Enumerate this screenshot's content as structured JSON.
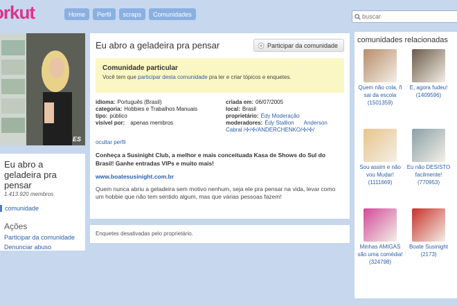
{
  "header": {
    "logo": "orkut",
    "nav": [
      "Home",
      "Perfil",
      "scraps",
      "Comunidades"
    ],
    "search_placeholder": "buscar"
  },
  "left": {
    "community_title": "Eu abro a geladeira pra pensar",
    "members": "1.413.920 membros",
    "comunidade_link": "comunidade",
    "acoes_heading": "Ações",
    "acoes": [
      "Participar da comunidade",
      "Denunciar abuso"
    ],
    "photo_watermark": "ES"
  },
  "main": {
    "title": "Eu abro a geladeira pra pensar",
    "join_button": "Participar da comunidade",
    "private_title": "Comunidade particular",
    "private_text_before": "Você tem que ",
    "private_text_link": "participar desta comunidade",
    "private_text_after": " pra ler e criar tópicos e enquetes.",
    "info": {
      "idioma_k": "idioma:",
      "idioma_v": "Português (Brasil)",
      "categoria_k": "categoria:",
      "categoria_v": "Hobbies e Trabalhos Manuais",
      "tipo_k": "tipo:",
      "tipo_v": "público",
      "visivel_k": "visível por:",
      "visivel_v": "apenas membros",
      "criada_k": "criada em:",
      "criada_v": "06/07/2005",
      "local_k": "local:",
      "local_v": "Brasil",
      "proprietario_k": "proprietário:",
      "proprietario_v": "Édy Moderação",
      "moderadores_k": "moderadores:",
      "moderadores_v1": "Édy Stallion",
      "moderadores_v2": "Anderson",
      "moderadores_v3": "Cabral /✣/✣/ANDERCHENKO/✣/✣/"
    },
    "ocultar": "ocultar perfil",
    "desc_bold": "Conheça a Susinight Club, a melhor e mais conceituada Kasa de Shows do Sul do Brasil! Ganhe entradas VIPs e muito mais!",
    "site": "www.boatesusinight.com.br",
    "desc": "Quem nunca abriu a geladeira sem motivo nenhum, seja ele pra pensar na vida, levar como um hobbie que não tem sentido algum, mas que várias pessoas fazem!",
    "enquetes": "Enquetes desativadas pelo proprietário."
  },
  "right": {
    "heading": "comunidades relacionadas",
    "items": [
      {
        "name": "Quem não cola, ñ sai da escola (1501359)",
        "color": "#b88c6a"
      },
      {
        "name": "E, agora fudeu! (1409596)",
        "color": "#6b5a48"
      },
      {
        "name": "Sou assim e não vou Mudar! (1111669)",
        "color": "#e8c48a"
      },
      {
        "name": "Eu não DESISTO facilmente! (770953)",
        "color": "#8aa0a8"
      },
      {
        "name": "Minhas AMIGAS são uma comédia! (324798)",
        "color": "#d24a9a"
      },
      {
        "name": "Boate Susinight (2173)",
        "color": "#c8302a"
      }
    ]
  }
}
